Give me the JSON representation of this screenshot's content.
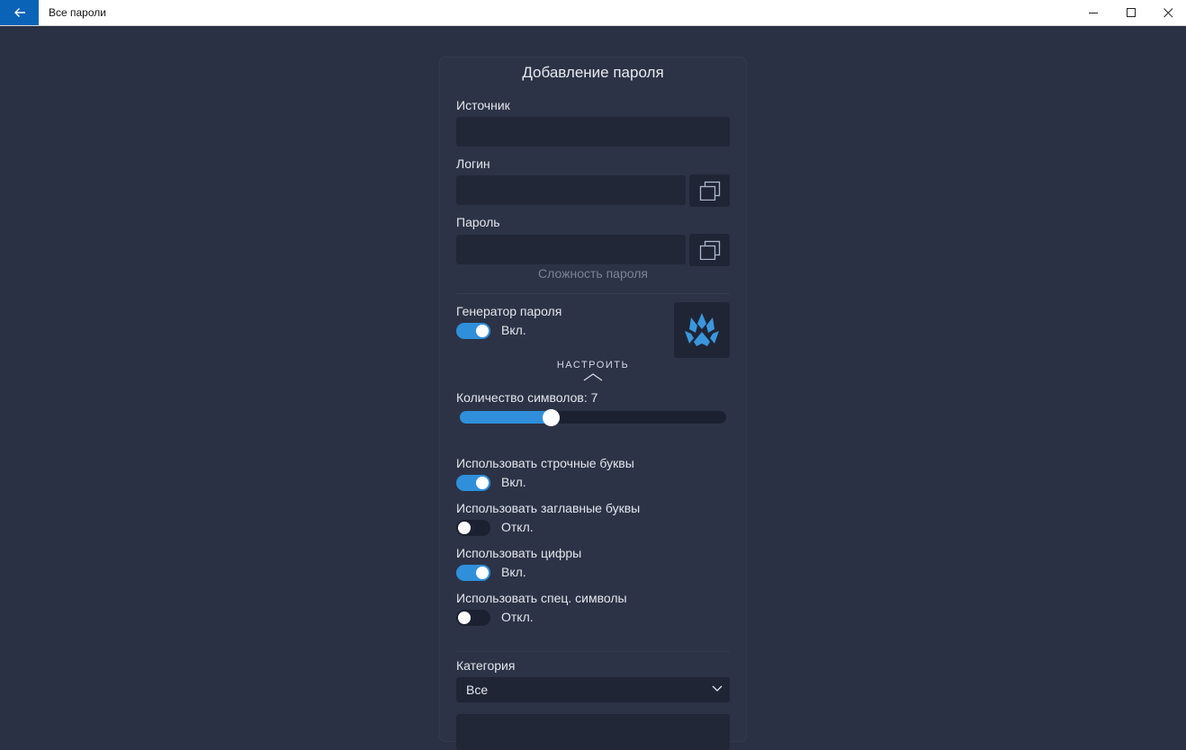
{
  "window": {
    "title": "Все пароли",
    "back_icon": "back-arrow-icon",
    "minimize_icon": "minimize-icon",
    "maximize_icon": "maximize-icon",
    "close_icon": "close-icon"
  },
  "form": {
    "title": "Добавление пароля",
    "source": {
      "label": "Источник",
      "value": ""
    },
    "login": {
      "label": "Логин",
      "value": "",
      "copy_icon": "copy-icon"
    },
    "password": {
      "label": "Пароль",
      "value": "",
      "copy_icon": "copy-icon",
      "strength_hint": "Сложность пароля"
    },
    "generator": {
      "label": "Генератор пароля",
      "state_text": "Вкл.",
      "enabled": true,
      "logo_icon": "paw-logo-icon",
      "configure_label": "НАСТРОИТЬ",
      "configure_icon": "chevron-up-icon"
    },
    "length": {
      "label": "Количество символов: 7",
      "value": 7,
      "fraction": 0.34
    },
    "options": [
      {
        "label": "Использовать строчные буквы",
        "state_text": "Вкл.",
        "enabled": true
      },
      {
        "label": "Использовать заглавные буквы",
        "state_text": "Откл.",
        "enabled": false
      },
      {
        "label": "Использовать цифры",
        "state_text": "Вкл.",
        "enabled": true
      },
      {
        "label": "Использовать спец. символы",
        "state_text": "Откл.",
        "enabled": false
      }
    ],
    "category": {
      "label": "Категория",
      "selected": "Все",
      "dropdown_icon": "chevron-down-icon"
    },
    "notes": {
      "placeholder": ""
    }
  },
  "colors": {
    "background": "#2b3144",
    "panel": "#2c3346",
    "input": "#212737",
    "accent": "#2f8fdb",
    "titlebar_accent": "#0b63b8"
  }
}
